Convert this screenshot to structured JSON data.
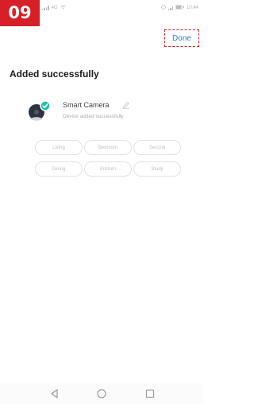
{
  "step": {
    "number": "09"
  },
  "status_bar": {
    "left_text": "4G",
    "time": "10:44"
  },
  "header": {
    "done_label": "Done"
  },
  "page": {
    "heading": "Added successfully"
  },
  "device": {
    "name": "Smart Camera",
    "status": "Device added successfully",
    "icon": "camera-with-check-icon",
    "check_color": "#1fc2a5"
  },
  "rooms": [
    {
      "label": "Living"
    },
    {
      "label": "Bedroom"
    },
    {
      "label": "Second"
    },
    {
      "label": "Dining"
    },
    {
      "label": "Kitchen"
    },
    {
      "label": "Study"
    }
  ],
  "colors": {
    "step_badge": "#d61f26",
    "done_text": "#3a7bd5",
    "highlight_border": "#d61f26"
  },
  "nav": {
    "back": "back-icon",
    "home": "home-icon",
    "recents": "recents-icon"
  }
}
